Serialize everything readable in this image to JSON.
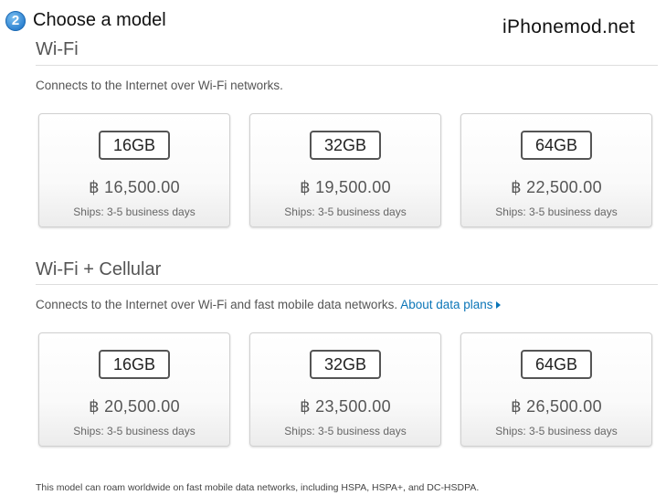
{
  "header": {
    "step_number": "2",
    "step_title": "Choose a model",
    "watermark": "iPhonemod.net"
  },
  "sections": [
    {
      "title": "Wi-Fi",
      "description": "Connects to the Internet over Wi-Fi networks.",
      "options": [
        {
          "capacity": "16GB",
          "price": "฿ 16,500.00",
          "ships": "Ships: 3-5 business days"
        },
        {
          "capacity": "32GB",
          "price": "฿ 19,500.00",
          "ships": "Ships: 3-5 business days"
        },
        {
          "capacity": "64GB",
          "price": "฿ 22,500.00",
          "ships": "Ships: 3-5 business days"
        }
      ]
    },
    {
      "title": "Wi-Fi + Cellular",
      "description": "Connects to the Internet over Wi-Fi and fast mobile data networks.",
      "link_text": "About data plans",
      "options": [
        {
          "capacity": "16GB",
          "price": "฿ 20,500.00",
          "ships": "Ships: 3-5 business days"
        },
        {
          "capacity": "32GB",
          "price": "฿ 23,500.00",
          "ships": "Ships: 3-5 business days"
        },
        {
          "capacity": "64GB",
          "price": "฿ 26,500.00",
          "ships": "Ships: 3-5 business days"
        }
      ]
    }
  ],
  "footnote": "This model can roam worldwide on fast mobile data networks, including HSPA, HSPA+, and DC-HSDPA.",
  "colors": {
    "link": "#0b76b8",
    "badge": "#2a7fcf"
  }
}
